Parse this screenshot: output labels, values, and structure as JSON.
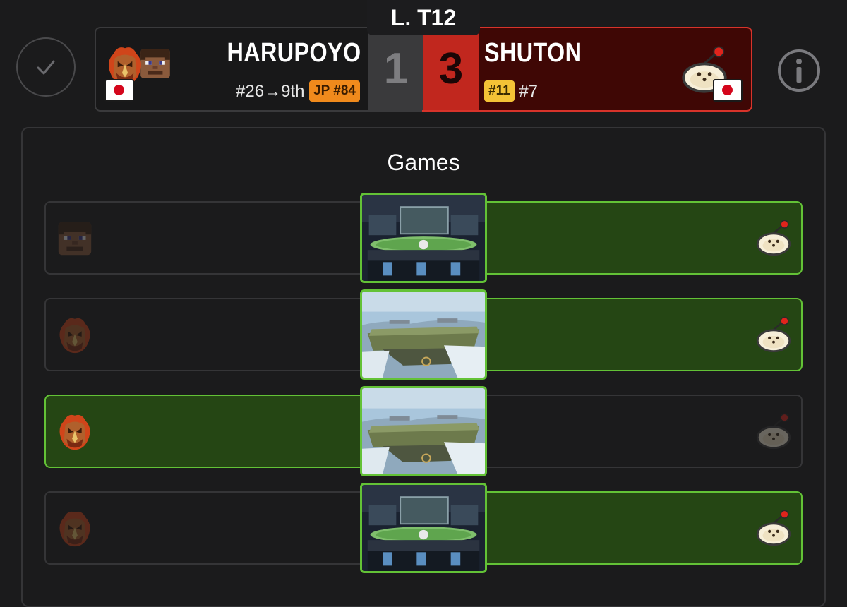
{
  "round": {
    "label": "L. T12"
  },
  "player1": {
    "name": "HARUPOYO",
    "placement": "#26→9th",
    "badge": "JP #84",
    "badge_color": "#f08a1c",
    "country": "Japan",
    "characters": [
      "ganondorf-icon",
      "steve-icon"
    ],
    "score": "1"
  },
  "player2": {
    "name": "SHUTON",
    "badge": "#11",
    "badge_color": "#f4c236",
    "seed": "#7",
    "country": "Japan",
    "characters": [
      "olimar-icon"
    ],
    "score": "3"
  },
  "colors": {
    "winner_green": "#63c236",
    "winner_fill": "#254614",
    "loser_red": "#c1271e"
  },
  "games_section": {
    "title": "Games",
    "games": [
      {
        "p1_character": "steve-icon",
        "p2_character": "olimar-icon",
        "stage": "pokemon-stadium-2-icon",
        "winner": "p2"
      },
      {
        "p1_character": "ganondorf-icon",
        "p2_character": "olimar-icon",
        "stage": "battlefield-icon",
        "winner": "p2"
      },
      {
        "p1_character": "ganondorf-icon",
        "p2_character": "olimar-icon",
        "stage": "battlefield-icon",
        "winner": "p1"
      },
      {
        "p1_character": "ganondorf-icon",
        "p2_character": "olimar-icon",
        "stage": "pokemon-stadium-2-icon",
        "winner": "p2"
      }
    ]
  }
}
